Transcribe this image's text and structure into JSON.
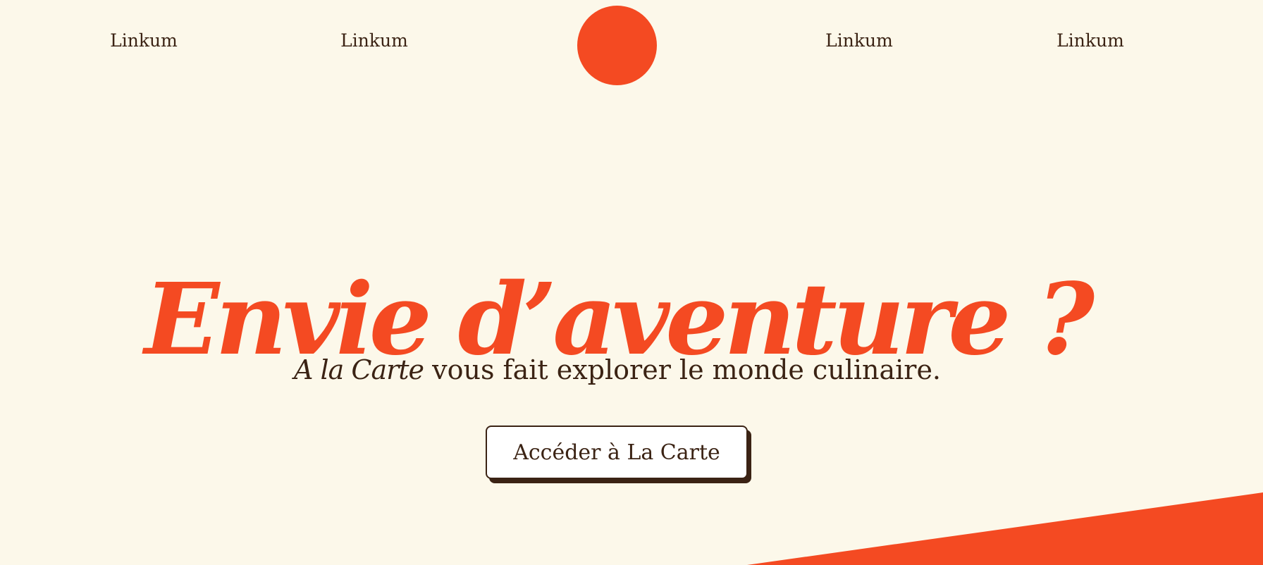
{
  "header": {
    "nav_links": [
      "Linkum",
      "Linkum",
      "Linkum",
      "Linkum"
    ]
  },
  "hero": {
    "title": "Envie d’aventure ?",
    "subtitle_brand": "A la Carte",
    "subtitle_rest": " vous fait explorer le monde culinaire.",
    "cta_label": "Accéder à La Carte"
  },
  "colors": {
    "background": "#fcf8ea",
    "accent": "#f44a22",
    "text": "#3b2314"
  }
}
